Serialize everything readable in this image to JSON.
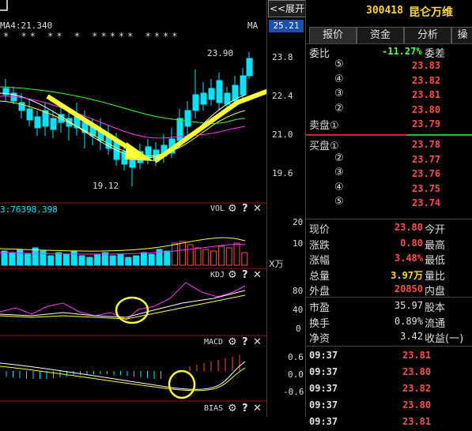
{
  "stock": {
    "code": "300418",
    "name": "昆仑万维"
  },
  "chart": {
    "ma_label": "MA4:21.340",
    "stars": "* ** ** * ***** ****",
    "ma_tag": "MA",
    "top_button": "<<展开",
    "top_price": "25.21",
    "high_label": "23.90",
    "low_label": "19.12",
    "price_axis": [
      "23.8",
      "22.4",
      "21.0",
      "19.6"
    ],
    "vol_label": "3:76398.398",
    "vol_tag": "VOL",
    "vol_axis": [
      "20",
      "10"
    ],
    "vol_unit": "X万",
    "kdj_tag": "KDJ",
    "kdj_axis": [
      "80",
      "40",
      "0"
    ],
    "macd_tag": "MACD",
    "macd_axis": [
      "0.6",
      "0.0",
      "-0.6"
    ],
    "bias_tag": "BIAS",
    "gear_icon": "⚙",
    "help_icon": "?",
    "close_icon": "✕"
  },
  "tabs": [
    "报价",
    "资金",
    "分析",
    "操"
  ],
  "weibi": {
    "label": "委比",
    "value": "-11.27%",
    "label2": "委差"
  },
  "sell": [
    {
      "label": "⑤",
      "price": "23.83"
    },
    {
      "label": "④",
      "price": "23.82"
    },
    {
      "label": "③",
      "price": "23.81"
    },
    {
      "label": "②",
      "price": "23.80"
    },
    {
      "label": "卖盘①",
      "price": "23.79"
    }
  ],
  "buy": [
    {
      "label": "买盘①",
      "price": "23.78"
    },
    {
      "label": "②",
      "price": "23.77"
    },
    {
      "label": "③",
      "price": "23.76"
    },
    {
      "label": "④",
      "price": "23.75"
    },
    {
      "label": "⑤",
      "price": "23.74"
    }
  ],
  "stats": [
    {
      "l1": "现价",
      "v1": "23.80",
      "l2": "今开",
      "c": "up"
    },
    {
      "l1": "涨跌",
      "v1": "0.80",
      "l2": "最高",
      "c": "up"
    },
    {
      "l1": "涨幅",
      "v1": "3.48%",
      "l2": "最低",
      "c": "up"
    },
    {
      "l1": "总量",
      "v1": "3.97万",
      "l2": "量比",
      "c": "yel"
    },
    {
      "l1": "外盘",
      "v1": "20850",
      "l2": "内盘",
      "c": "wht"
    }
  ],
  "stats2": [
    {
      "l1": "市盈",
      "v1": "35.97",
      "l2": "股本"
    },
    {
      "l1": "换手",
      "v1": "0.89%",
      "l2": "流通"
    },
    {
      "l1": "净资",
      "v1": "3.42",
      "l2": "收益(一)"
    }
  ],
  "ticks": [
    {
      "time": "09:37",
      "price": "23.81"
    },
    {
      "time": "09:37",
      "price": "23.80"
    },
    {
      "time": "09:37",
      "price": "23.82"
    },
    {
      "time": "09:37",
      "price": "23.80"
    },
    {
      "time": "09:37",
      "price": "23.81"
    }
  ],
  "colors": {
    "up": "#ff4d4d",
    "down": "#54ff54",
    "bg": "#000000",
    "accent": "#ffff33",
    "cyan": "#00e5ff"
  }
}
